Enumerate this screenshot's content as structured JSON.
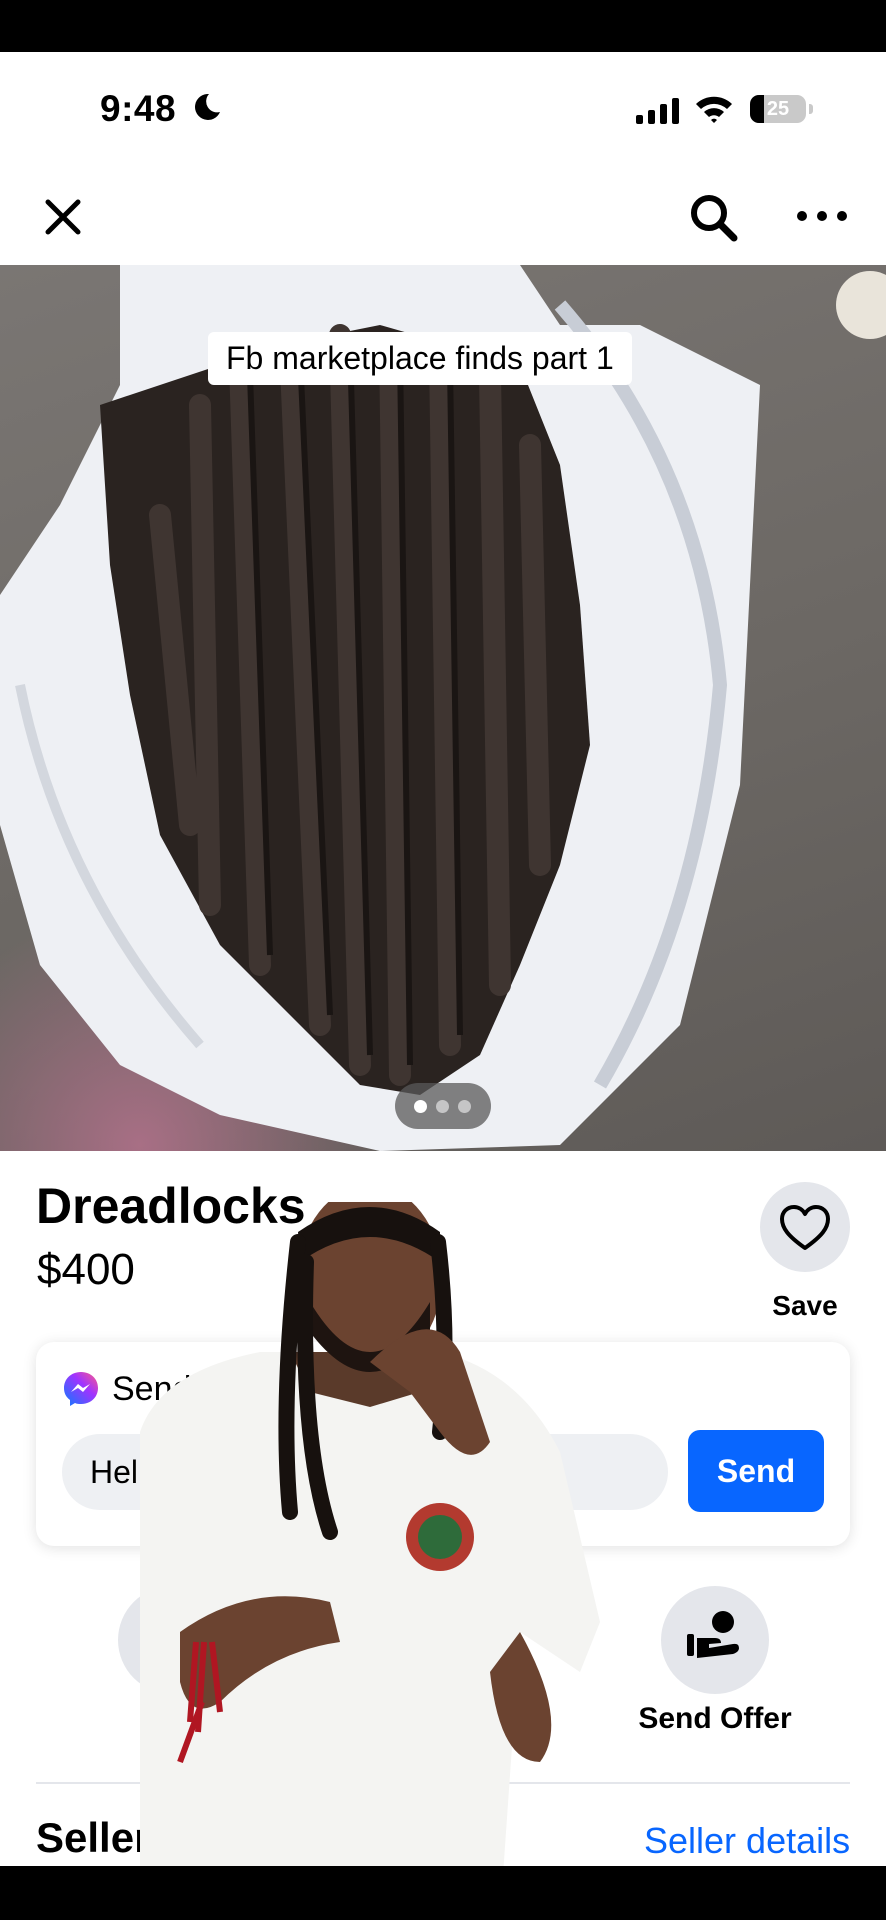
{
  "status_bar": {
    "time": "9:48",
    "battery": "25",
    "battery_level": 0.25
  },
  "nav": {
    "close_icon": "close-icon",
    "search_icon": "search-icon",
    "more_icon": "more-options-icon"
  },
  "photo": {
    "caption": "Fb marketplace finds part 1",
    "page_count": 3,
    "current_page": 1
  },
  "listing": {
    "title": "Dreadlocks",
    "price": "$400",
    "save_label": "Save"
  },
  "message": {
    "title": "Send",
    "input_value": "Hel",
    "send_label": "Send"
  },
  "actions": {
    "send_offer_label": "Send Offer"
  },
  "seller": {
    "heading": "Seller information",
    "details_link": "Seller details"
  },
  "colors": {
    "accent": "#0866ff",
    "chip_bg": "#e4e6eb"
  }
}
